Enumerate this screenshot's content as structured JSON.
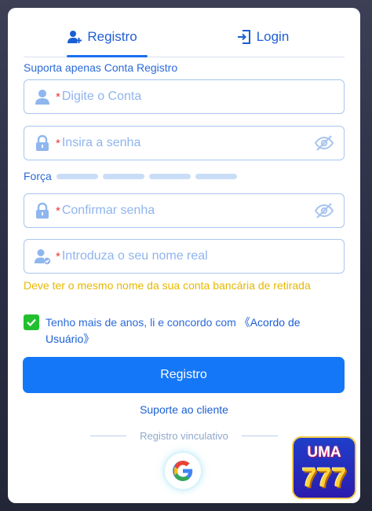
{
  "tabs": {
    "register": "Registro",
    "login": "Login"
  },
  "subtitle": "Suporta apenas Conta Registro",
  "fields": {
    "account": {
      "required_mark": "*",
      "placeholder": "Digite o Conta",
      "value": ""
    },
    "password": {
      "required_mark": "*",
      "placeholder": "Insira a senha",
      "value": ""
    },
    "confirm": {
      "required_mark": "*",
      "placeholder": "Confirmar senha",
      "value": ""
    },
    "realname": {
      "required_mark": "*",
      "placeholder": "Introduza o seu nome real",
      "value": ""
    }
  },
  "strength": {
    "label": "Força",
    "segments": 4,
    "level": 0
  },
  "warning": "Deve ter o mesmo nome da sua conta bancária de retirada",
  "agreement": {
    "checked": true,
    "text": "Tenho mais de anos, li e concordo com ",
    "link": "《Acordo de Usuário》"
  },
  "submit_label": "Registro",
  "support_label": "Suporte ao cliente",
  "bind_label": "Registro vinculativo",
  "badge": {
    "line1": "UMA",
    "line2": "777"
  },
  "colors": {
    "primary": "#1477f8",
    "text_blue": "#2a6ad8",
    "warning": "#e6b800",
    "checkbox": "#22c02f",
    "required": "#e53935"
  }
}
